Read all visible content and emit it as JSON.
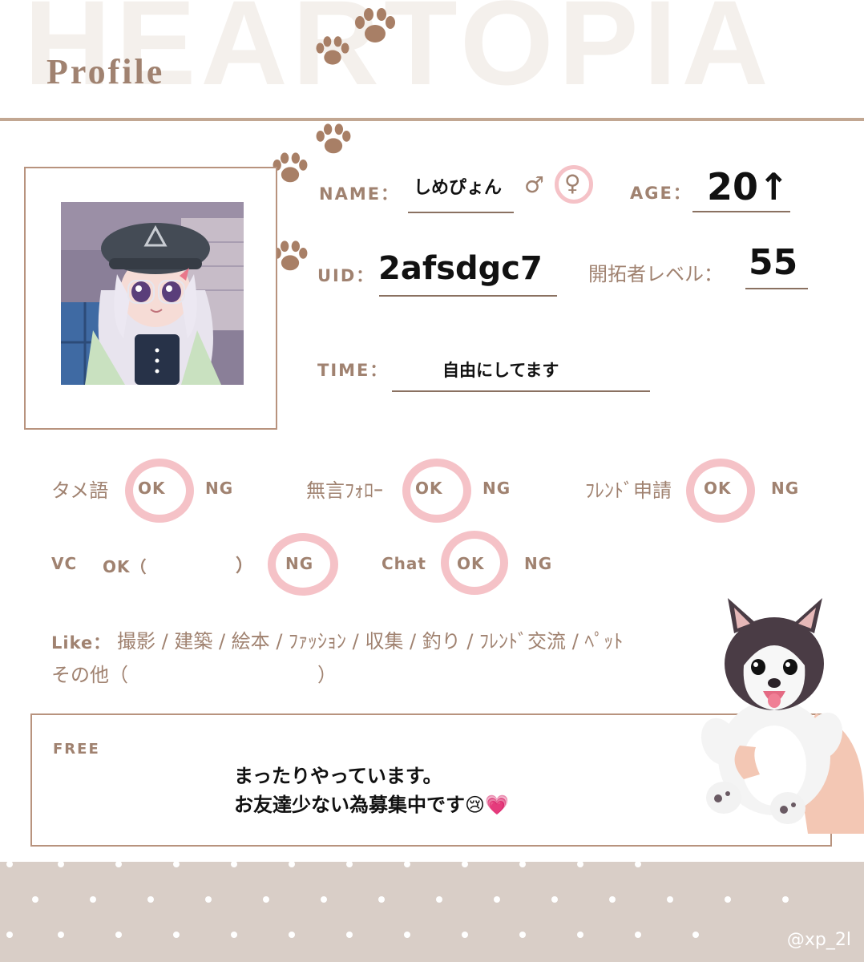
{
  "background_word": "HEARTOPIA",
  "title": "Profile",
  "name": {
    "label": "NAME：",
    "value": "しめぴょん",
    "male_symbol": "♂",
    "female_symbol": "♀",
    "selected_gender": "female"
  },
  "age": {
    "label": "AGE：",
    "value": "20↑"
  },
  "uid": {
    "label": "UID：",
    "value": "2afsdgc7"
  },
  "level": {
    "label": "開拓者レベル：",
    "value": "55"
  },
  "time": {
    "label": "TIME：",
    "value": "自由にしてます"
  },
  "prefs": {
    "tame": {
      "label": "タメ語",
      "ok": "OK",
      "ng": "NG",
      "selected": "OK"
    },
    "follow": {
      "label": "無言ﾌｫﾛｰ",
      "ok": "OK",
      "ng": "NG",
      "selected": "OK"
    },
    "friend": {
      "label": "ﾌﾚﾝﾄﾞ申請",
      "ok": "OK",
      "ng": "NG",
      "selected": "OK"
    },
    "vc": {
      "label": "VC",
      "ok": "OK（",
      "close": "）",
      "ng": "NG",
      "selected": "NG"
    },
    "chat": {
      "label": "Chat",
      "ok": "OK",
      "ng": "NG",
      "selected": "OK"
    }
  },
  "like": {
    "label": "Like：",
    "line1": "撮影 / 建築 / 絵本 / ﾌｧｯｼｮﾝ /  収集 / 釣り / ﾌﾚﾝﾄﾞ交流 / ﾍﾟｯﾄ",
    "line2_open": "その他（",
    "line2_close": "）"
  },
  "free": {
    "label": "FREE",
    "line1": "まったりやっています。",
    "line2": "お友達少ない為募集中です😢💗"
  },
  "handle": "@xp_2l",
  "colors": {
    "accent_brown": "#a08270",
    "ring_pink": "#f5c2c7",
    "footer_beige": "#d9cec7"
  },
  "icons": [
    "paw-icon",
    "avatar-photo",
    "husky-plush-illustration"
  ]
}
